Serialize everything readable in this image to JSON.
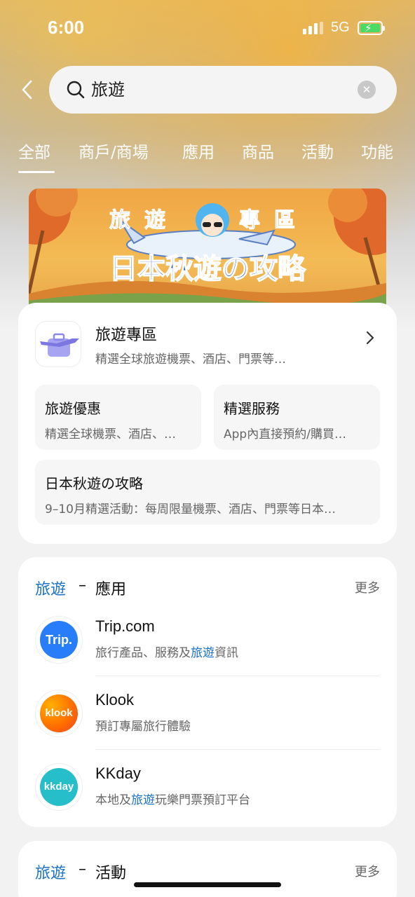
{
  "status_bar": {
    "time": "6:00",
    "network": "5G"
  },
  "search": {
    "query": "旅遊"
  },
  "tabs": [
    {
      "label": "全部"
    },
    {
      "label": "商戶/商場"
    },
    {
      "label": "應用"
    },
    {
      "label": "商品"
    },
    {
      "label": "活動"
    },
    {
      "label": "功能"
    }
  ],
  "banner": {
    "line1": [
      "旅",
      "遊",
      "專",
      "區"
    ],
    "line2": "日本秋遊の攻略"
  },
  "travel_zone": {
    "title": "旅遊專區",
    "subtitle": "精選全球旅遊機票、酒店、門票等…",
    "tiles": [
      {
        "title": "旅遊優惠",
        "subtitle": "精選全球機票、酒店、…"
      },
      {
        "title": "精選服務",
        "subtitle": "App內直接預約/購買…"
      },
      {
        "title": "日本秋遊の攻略",
        "subtitle": "9–10月精選活動：每周限量機票、酒店、門票等日本…"
      }
    ]
  },
  "apps_section": {
    "keyword": "旅遊",
    "dash": "–",
    "category": "應用",
    "more": "更多",
    "items": [
      {
        "name": "Trip.com",
        "logo_text": "Trip.",
        "logo_color": "#287dfa",
        "desc_before": "旅行產品、服務及",
        "desc_highlight": "旅遊",
        "desc_after": "資訊"
      },
      {
        "name": "Klook",
        "logo_text": "klook",
        "logo_color": "#ff5b00",
        "desc_before": "預訂專屬旅行體驗",
        "desc_highlight": "",
        "desc_after": ""
      },
      {
        "name": "KKday",
        "logo_text": "kkday",
        "logo_color": "#26bec9",
        "desc_before": "本地及",
        "desc_highlight": "旅遊",
        "desc_after": "玩樂門票預訂平台"
      }
    ]
  },
  "activities_section": {
    "keyword": "旅遊",
    "dash": "–",
    "category": "活動",
    "more": "更多"
  },
  "colors": {
    "accent": "#1a72c8"
  }
}
